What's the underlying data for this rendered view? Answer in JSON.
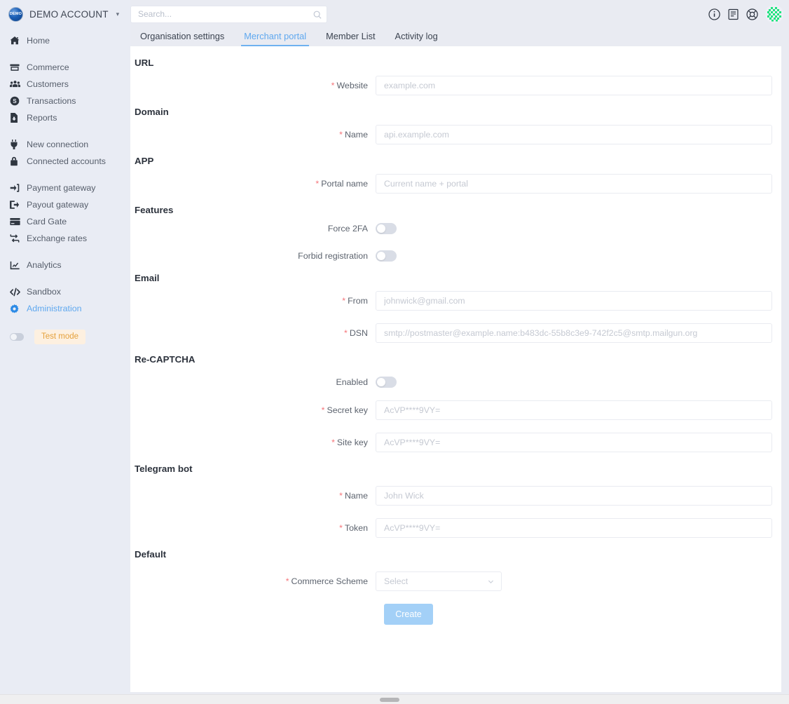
{
  "brand": {
    "logo_text": "DEMO",
    "logo_icon": "demo-logo-badge",
    "name": "DEMO ACCOUNT",
    "caret_icon": "chevron-down-icon"
  },
  "search": {
    "placeholder": "Search...",
    "value": "",
    "icon": "search-icon"
  },
  "top_icons": [
    {
      "name": "info-icon",
      "label": "Info"
    },
    {
      "name": "docs-icon",
      "label": "Documentation"
    },
    {
      "name": "support-icon",
      "label": "Support"
    },
    {
      "name": "avatar",
      "label": "User avatar"
    }
  ],
  "sidebar": {
    "groups": [
      {
        "items": [
          {
            "label": "Home",
            "icon": "home-icon",
            "active": false
          }
        ]
      },
      {
        "items": [
          {
            "label": "Commerce",
            "icon": "store-icon",
            "active": false
          },
          {
            "label": "Customers",
            "icon": "users-icon",
            "active": false
          },
          {
            "label": "Transactions",
            "icon": "dollar-circle-icon",
            "active": false
          },
          {
            "label": "Reports",
            "icon": "report-file-icon",
            "active": false
          }
        ]
      },
      {
        "items": [
          {
            "label": "New connection",
            "icon": "plug-icon",
            "active": false
          },
          {
            "label": "Connected accounts",
            "icon": "lock-icon",
            "active": false
          }
        ]
      },
      {
        "items": [
          {
            "label": "Payment gateway",
            "icon": "sign-in-icon",
            "active": false
          },
          {
            "label": "Payout gateway",
            "icon": "sign-out-icon",
            "active": false
          },
          {
            "label": "Card Gate",
            "icon": "credit-card-icon",
            "active": false
          },
          {
            "label": "Exchange rates",
            "icon": "exchange-icon",
            "active": false
          }
        ]
      },
      {
        "items": [
          {
            "label": "Analytics",
            "icon": "chart-icon",
            "active": false
          }
        ]
      },
      {
        "items": [
          {
            "label": "Sandbox",
            "icon": "code-icon",
            "active": false
          },
          {
            "label": "Administration",
            "icon": "gear-icon",
            "active": true
          }
        ]
      }
    ],
    "test_mode": {
      "label": "Test mode",
      "toggle_icon": "toggle-off-icon",
      "enabled": false
    }
  },
  "tabs": [
    {
      "label": "Organisation settings",
      "active": false
    },
    {
      "label": "Merchant portal",
      "active": true
    },
    {
      "label": "Member List",
      "active": false
    },
    {
      "label": "Activity log",
      "active": false
    }
  ],
  "form": {
    "sections": [
      {
        "title": "URL",
        "rows": [
          {
            "type": "input",
            "label": "Website",
            "required": true,
            "placeholder": "example.com",
            "value": ""
          }
        ]
      },
      {
        "title": "Domain",
        "rows": [
          {
            "type": "input",
            "label": "Name",
            "required": true,
            "placeholder": "api.example.com",
            "value": ""
          }
        ]
      },
      {
        "title": "APP",
        "rows": [
          {
            "type": "input",
            "label": "Portal name",
            "required": true,
            "placeholder": "Current name + portal",
            "value": ""
          }
        ]
      },
      {
        "title": "Features",
        "rows": [
          {
            "type": "switch",
            "label": "Force 2FA",
            "required": false,
            "enabled": false
          },
          {
            "type": "switch",
            "label": "Forbid registration",
            "required": false,
            "enabled": false
          }
        ]
      },
      {
        "title": "Email",
        "rows": [
          {
            "type": "input",
            "label": "From",
            "required": true,
            "placeholder": "johnwick@gmail.com",
            "value": ""
          },
          {
            "type": "input",
            "label": "DSN",
            "required": true,
            "placeholder": "smtp://postmaster@example.name:b483dc-55b8c3e9-742f2c5@smtp.mailgun.org",
            "value": ""
          }
        ]
      },
      {
        "title": "Re-CAPTCHA",
        "rows": [
          {
            "type": "switch",
            "label": "Enabled",
            "required": false,
            "enabled": false
          },
          {
            "type": "input",
            "label": "Secret key",
            "required": true,
            "placeholder": "AcVP****9VY=",
            "value": ""
          },
          {
            "type": "input",
            "label": "Site key",
            "required": true,
            "placeholder": "AcVP****9VY=",
            "value": ""
          }
        ]
      },
      {
        "title": "Telegram bot",
        "rows": [
          {
            "type": "input",
            "label": "Name",
            "required": true,
            "placeholder": "John Wick",
            "value": ""
          },
          {
            "type": "input",
            "label": "Token",
            "required": true,
            "placeholder": "AcVP****9VY=",
            "value": ""
          }
        ]
      },
      {
        "title": "Default",
        "rows": [
          {
            "type": "select",
            "label": "Commerce Scheme",
            "required": true,
            "placeholder": "Select",
            "value": "",
            "caret_icon": "chevron-down-icon"
          }
        ]
      }
    ],
    "submit_label": "Create"
  },
  "colors": {
    "accent": "#5fa8ef",
    "required_star": "#f5757a",
    "sidebar_bg": "#e9ecf4",
    "page_bg": "#e9ebf2",
    "test_mode_badge_text": "#e5a13c",
    "test_mode_badge_bg": "#fdf0e0",
    "button": "#a3d0f7",
    "avatar_green": "#2de68a"
  }
}
